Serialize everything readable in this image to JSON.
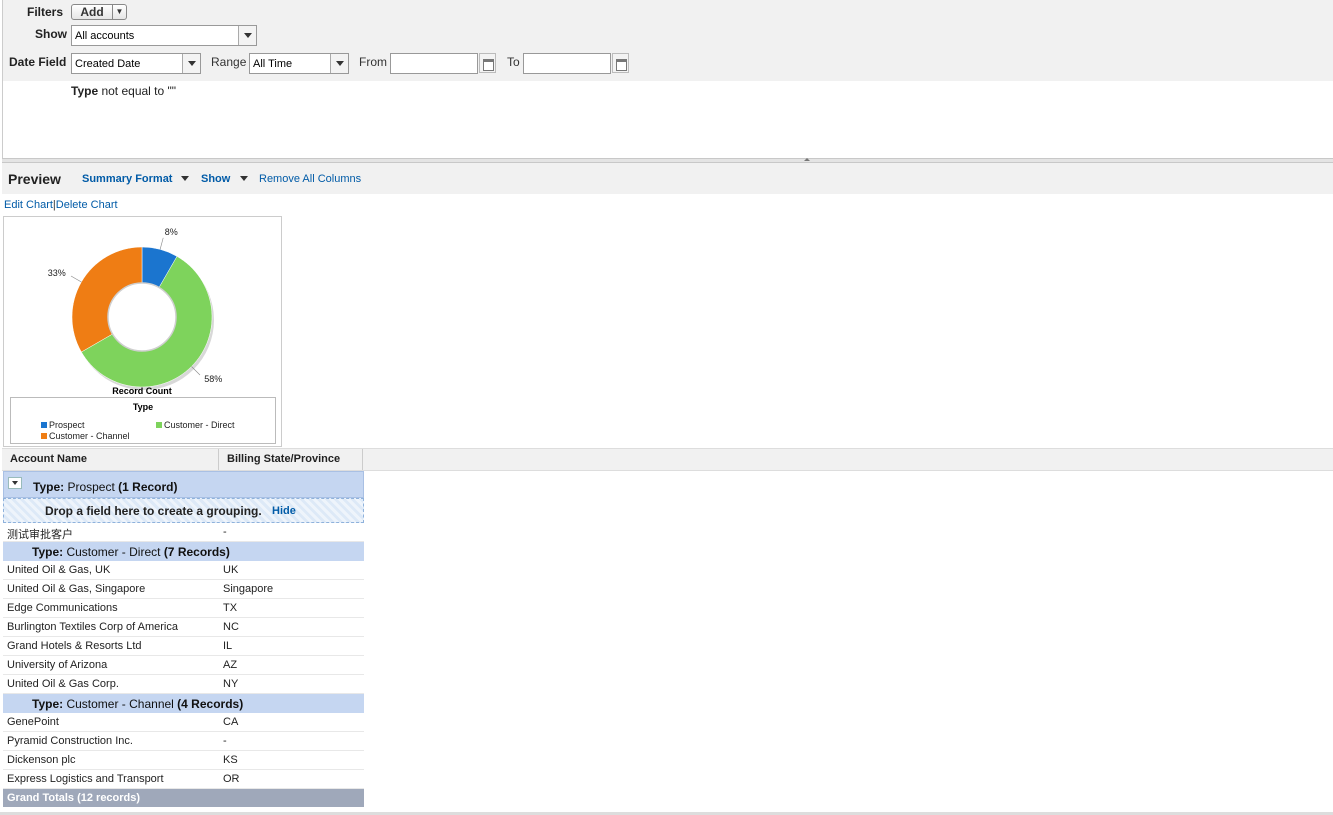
{
  "filters": {
    "filters_label": "Filters",
    "add_label": "Add",
    "show_label": "Show",
    "show_value": "All accounts",
    "date_field_label": "Date Field",
    "date_field_value": "Created Date",
    "range_label": "Range",
    "range_value": "All Time",
    "from_label": "From",
    "to_label": "To",
    "from_value": "",
    "to_value": "",
    "criteria_field": "Type",
    "criteria_rest": " not equal to \"\""
  },
  "preview": {
    "title": "Preview",
    "format_label": "Summary Format",
    "show_label": "Show",
    "remove_label": "Remove All Columns",
    "edit_chart": "Edit Chart",
    "separator": "|",
    "delete_chart": "Delete Chart"
  },
  "chart_data": {
    "type": "pie",
    "variant": "donut",
    "title": "",
    "metric_label": "Record Count",
    "legend_title": "Type",
    "legend_placement": "bottom",
    "slices": [
      {
        "name": "Prospect",
        "value": 1,
        "label": "8%",
        "color": "#1b75cf"
      },
      {
        "name": "Customer - Direct",
        "value": 7,
        "label": "58%",
        "color": "#7ed35c"
      },
      {
        "name": "Customer - Channel",
        "value": 4,
        "label": "33%",
        "color": "#ef7d14"
      }
    ]
  },
  "table": {
    "columns": [
      "Account Name",
      "Billing State/Province"
    ],
    "drop_zone_text": "Drop a field here to create a grouping.",
    "drop_zone_hide": "Hide",
    "groups": [
      {
        "type_label": "Type:",
        "type_value": "Prospect",
        "count_text": "(1 Record)",
        "rows": [
          [
            "测试审批客户",
            "-"
          ]
        ]
      },
      {
        "type_label": "Type:",
        "type_value": "Customer - Direct",
        "count_text": "(7 Records)",
        "rows": [
          [
            "United Oil & Gas, UK",
            "UK"
          ],
          [
            "United Oil & Gas, Singapore",
            "Singapore"
          ],
          [
            "Edge Communications",
            "TX"
          ],
          [
            "Burlington Textiles Corp of America",
            "NC"
          ],
          [
            "Grand Hotels & Resorts Ltd",
            "IL"
          ],
          [
            "University of Arizona",
            "AZ"
          ],
          [
            "United Oil & Gas Corp.",
            "NY"
          ]
        ]
      },
      {
        "type_label": "Type:",
        "type_value": "Customer - Channel",
        "count_text": "(4 Records)",
        "rows": [
          [
            "GenePoint",
            "CA"
          ],
          [
            "Pyramid Construction Inc.",
            "-"
          ],
          [
            "Dickenson plc",
            "KS"
          ],
          [
            "Express Logistics and Transport",
            "OR"
          ]
        ]
      }
    ],
    "grand_total": "Grand Totals (12 records)"
  }
}
